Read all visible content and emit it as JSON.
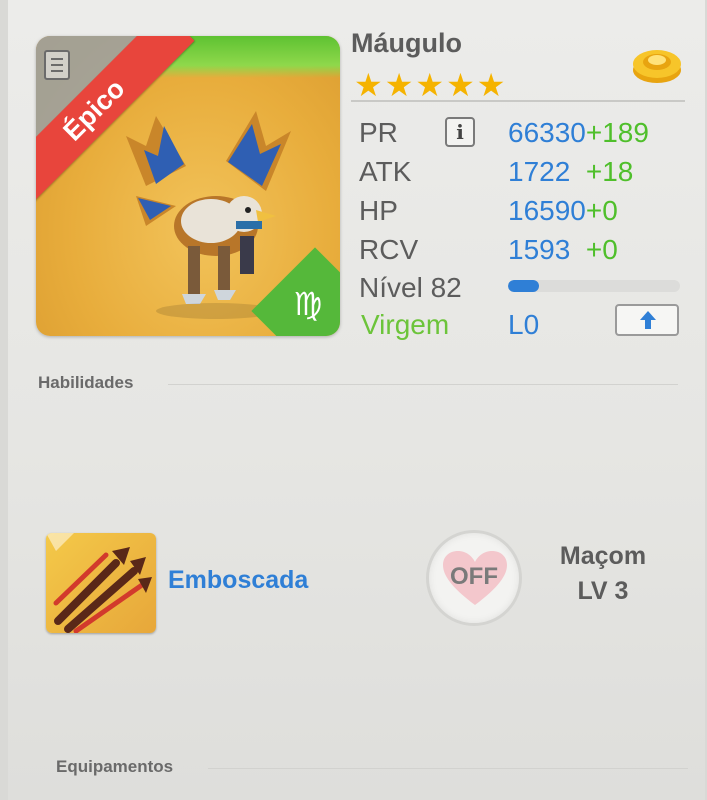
{
  "hero": {
    "name": "Máugulo",
    "rarity": "Épico",
    "stars": "★★★★★",
    "zodiac_symbol": "♍",
    "zodiac_name": "Virgem",
    "currency_icon": "gold-coins-icon"
  },
  "stats": [
    {
      "label": "PR",
      "value": "66330",
      "bonus": "+189"
    },
    {
      "label": "ATK",
      "value": "1722",
      "bonus": "+18"
    },
    {
      "label": "HP",
      "value": "16590",
      "bonus": "+0"
    },
    {
      "label": "RCV",
      "value": "1593",
      "bonus": "+0"
    }
  ],
  "level": {
    "label": "Nível 82",
    "progress": 0.18
  },
  "limit": {
    "value": "L0"
  },
  "info_button": "i",
  "sections": {
    "skills_title": "Habilidades",
    "equipment_title": "Equipamentos"
  },
  "skill": {
    "name": "Emboscada",
    "toggle_label": "OFF"
  },
  "companion": {
    "name": "Maçom",
    "level": "LV 3"
  },
  "colors": {
    "accent_blue": "#2f7fd6",
    "bonus_green": "#4fbf2b",
    "ribbon_red": "#e8453c",
    "star_gold": "#f5b300"
  }
}
